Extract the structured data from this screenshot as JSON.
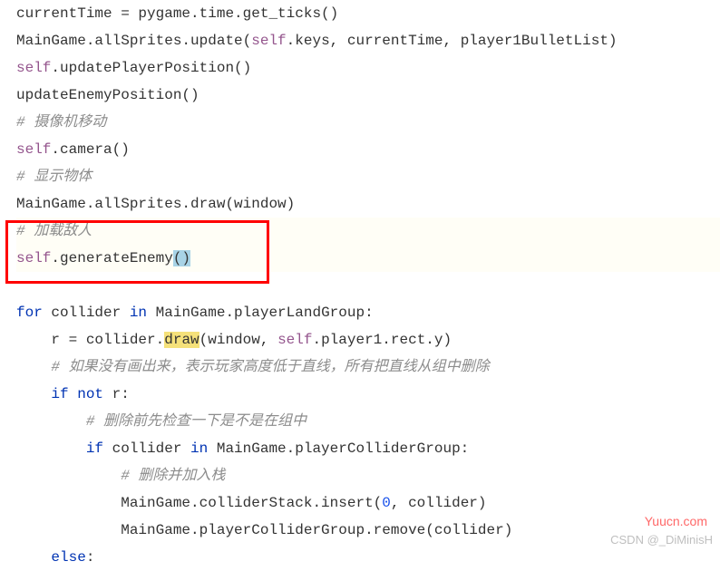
{
  "code": {
    "l1": {
      "a": "currentTime = pygame.time.get_ticks()"
    },
    "l2": {
      "a": "MainGame.allSprites.update(",
      "self": "self",
      "b": ".keys, currentTime, player1BulletList)"
    },
    "l3": {
      "self": "self",
      "a": ".updatePlayerPosition()"
    },
    "l4": {
      "a": "updateEnemyPosition()"
    },
    "l5": {
      "a": "# 摄像机移动"
    },
    "l6": {
      "self": "self",
      "a": ".camera()"
    },
    "l7": {
      "a": "# 显示物体"
    },
    "l8": {
      "a": "MainGame.allSprites.draw(window)"
    },
    "l9": {
      "a": "# 加载敌人"
    },
    "l10": {
      "self": "self",
      "a": ".generateEnemy",
      "p": "()"
    },
    "l12": {
      "for": "for",
      "a": " collider ",
      "in": "in",
      "b": " MainGame.playerLandGroup:"
    },
    "l13": {
      "a": "r = collider.",
      "draw": "draw",
      "b": "(window, ",
      "self": "self",
      "c": ".player1.rect.y)"
    },
    "l14": {
      "a": "# 如果没有画出来，表示玩家高度低于直线，所有把直线从组中删除"
    },
    "l15": {
      "if": "if",
      "not": "not",
      "a": " r:"
    },
    "l16": {
      "a": "# 删除前先检查一下是不是在组中"
    },
    "l17": {
      "if": "if",
      "a": " collider ",
      "in": "in",
      "b": " MainGame.playerColliderGroup:"
    },
    "l18": {
      "a": "# 删除并加入栈"
    },
    "l19": {
      "a": "MainGame.colliderStack.insert(",
      "num": "0",
      "b": ", collider)"
    },
    "l20": {
      "a": "MainGame.playerColliderGroup.remove(collider)"
    },
    "l21": {
      "else": "else",
      "a": ":"
    }
  },
  "watermark1": "Yuucn.com",
  "watermark2": "CSDN @_DiMinisH"
}
